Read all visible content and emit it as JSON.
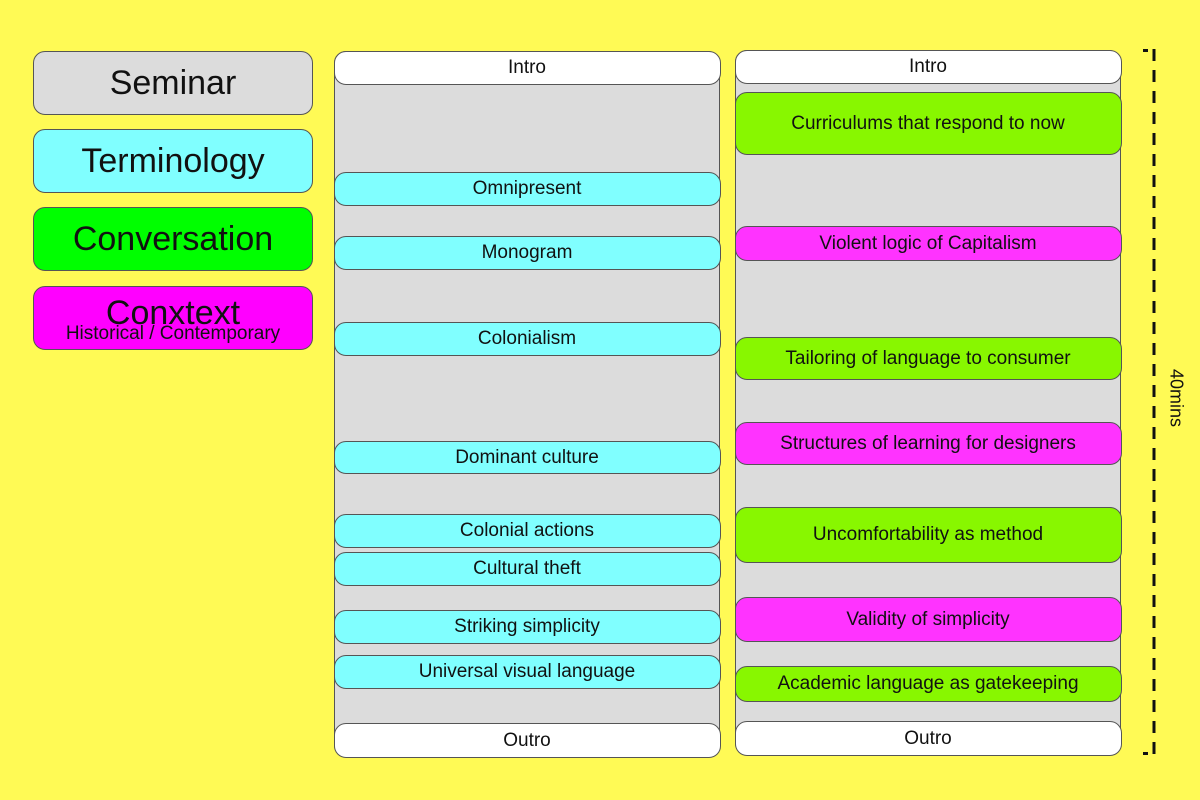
{
  "legend": {
    "seminar": {
      "label": "Seminar"
    },
    "terminology": {
      "label": "Terminology"
    },
    "conversation": {
      "label": "Conversation"
    },
    "context": {
      "label": "Conxtext",
      "sublabel": "Historical / Contemporary"
    }
  },
  "colors": {
    "background": "#fffa55",
    "seminar": "#dcdcdc",
    "terminology": "#80ffff",
    "conversation_legend": "#00ff00",
    "conversation_item": "#88f700",
    "context": "#ff33ff",
    "intro_outro": "#ffffff"
  },
  "columns": [
    {
      "items": [
        {
          "label": "Intro",
          "category": "intro"
        },
        {
          "label": "Omnipresent",
          "category": "terminology"
        },
        {
          "label": "Monogram",
          "category": "terminology"
        },
        {
          "label": "Colonialism",
          "category": "terminology"
        },
        {
          "label": "Dominant culture",
          "category": "terminology"
        },
        {
          "label": "Colonial actions",
          "category": "terminology"
        },
        {
          "label": "Cultural theft",
          "category": "terminology"
        },
        {
          "label": "Striking simplicity",
          "category": "terminology"
        },
        {
          "label": "Universal visual language",
          "category": "terminology"
        },
        {
          "label": "Outro",
          "category": "outro"
        }
      ]
    },
    {
      "items": [
        {
          "label": "Intro",
          "category": "intro"
        },
        {
          "label": "Curriculums that respond to now",
          "category": "conversation"
        },
        {
          "label": "Violent logic of Capitalism",
          "category": "context"
        },
        {
          "label": "Tailoring of language to consumer",
          "category": "conversation"
        },
        {
          "label": "Structures of learning for designers",
          "category": "context"
        },
        {
          "label": "Uncomfortability as method",
          "category": "conversation"
        },
        {
          "label": "Validity of simplicity",
          "category": "context"
        },
        {
          "label": "Academic language as gatekeeping",
          "category": "conversation"
        },
        {
          "label": "Outro",
          "category": "outro"
        }
      ]
    }
  ],
  "duration": {
    "label": "40mins"
  }
}
